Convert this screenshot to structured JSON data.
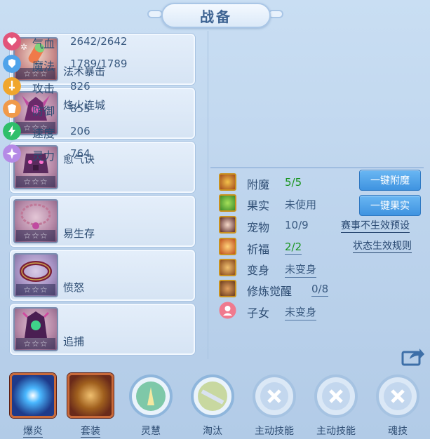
{
  "title": "战备",
  "equipment": [
    {
      "name": "法术暴击",
      "stars": "☆☆☆"
    },
    {
      "name": "烽火连城",
      "stars": "☆☆☆"
    },
    {
      "name": "愈气诀",
      "stars": "☆☆☆"
    },
    {
      "name": "易生存",
      "stars": "☆☆☆"
    },
    {
      "name": "愤怒",
      "stars": "☆☆☆"
    },
    {
      "name": "追捕",
      "stars": "☆☆☆"
    }
  ],
  "stats": [
    {
      "label": "气血",
      "value": "2642/2642",
      "icon": "heart-icon",
      "color": "#e2557a"
    },
    {
      "label": "魔法",
      "value": "1789/1789",
      "icon": "shield-icon",
      "color": "#4fa3ea"
    },
    {
      "label": "攻击",
      "value": "826",
      "icon": "sword-icon",
      "color": "#f0a62c"
    },
    {
      "label": "防御",
      "value": "855",
      "icon": "armor-icon",
      "color": "#f09a4a"
    },
    {
      "label": "速度",
      "value": "206",
      "icon": "lightning-icon",
      "color": "#2fbf6a"
    },
    {
      "label": "灵力",
      "value": "764",
      "icon": "spirit-icon",
      "color": "#b58ae6"
    }
  ],
  "features": [
    {
      "label": "附魔",
      "value": "5/5",
      "icon": "enchant-icon"
    },
    {
      "label": "果实",
      "value": "未使用",
      "icon": "fruit-icon"
    },
    {
      "label": "宠物",
      "value": "10/9",
      "icon": "pet-icon"
    },
    {
      "label": "祈福",
      "value": "2/2",
      "icon": "blessing-icon"
    },
    {
      "label": "变身",
      "value": "未变身",
      "icon": "transform-icon"
    },
    {
      "label": "修炼觉醒",
      "value": "0/8",
      "icon": "cultivation-icon"
    },
    {
      "label": "子女",
      "value": "未变身",
      "icon": "child-icon"
    }
  ],
  "buttons": {
    "enchant": "一键附魔",
    "fruit": "一键果实"
  },
  "links": {
    "preset": "赛事不生效预设",
    "rules": "状态生效规则"
  },
  "skills": [
    {
      "label": "爆炎"
    },
    {
      "label": "套装"
    },
    {
      "label": "灵慧"
    },
    {
      "label": "淘汰"
    },
    {
      "label": "主动技能"
    },
    {
      "label": "主动技能"
    },
    {
      "label": "魂技"
    }
  ],
  "colors": {
    "background": "#c3d8ef",
    "accent_blue": "#4a9be4",
    "green_value": "#19951f"
  }
}
